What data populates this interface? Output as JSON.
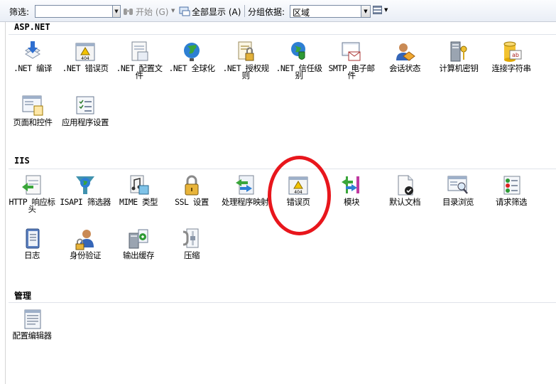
{
  "toolbar": {
    "filter_label": "筛选:",
    "filter_value": "",
    "go_label": "开始 (G)",
    "show_all_label": "全部显示 (A)",
    "group_by_label": "分组依据:",
    "group_by_value": "区域"
  },
  "sections": [
    {
      "title": "ASP.NET",
      "items": [
        {
          "label": ".NET 编译",
          "icon": "net-compile-icon"
        },
        {
          "label": ".NET 错误页",
          "icon": "net-error-pages-icon"
        },
        {
          "label": ".NET 配置文件",
          "icon": "net-profile-icon"
        },
        {
          "label": ".NET 全球化",
          "icon": "globe-icon"
        },
        {
          "label": ".NET 授权规则",
          "icon": "authorization-rules-icon"
        },
        {
          "label": ".NET 信任级别",
          "icon": "trust-levels-icon"
        },
        {
          "label": "SMTP 电子邮件",
          "icon": "smtp-email-icon"
        },
        {
          "label": "会话状态",
          "icon": "session-state-icon"
        },
        {
          "label": "计算机密钥",
          "icon": "machine-key-icon"
        },
        {
          "label": "连接字符串",
          "icon": "connection-strings-icon"
        },
        {
          "label": "页面和控件",
          "icon": "pages-controls-icon"
        },
        {
          "label": "应用程序设置",
          "icon": "app-settings-icon"
        }
      ]
    },
    {
      "title": "IIS",
      "items": [
        {
          "label": "HTTP 响应标头",
          "icon": "http-headers-icon"
        },
        {
          "label": "ISAPI 筛选器",
          "icon": "isapi-filters-icon"
        },
        {
          "label": "MIME 类型",
          "icon": "mime-types-icon"
        },
        {
          "label": "SSL 设置",
          "icon": "lock-icon"
        },
        {
          "label": "处理程序映射",
          "icon": "handler-mappings-icon"
        },
        {
          "label": "错误页",
          "icon": "error-pages-icon"
        },
        {
          "label": "模块",
          "icon": "modules-icon"
        },
        {
          "label": "默认文档",
          "icon": "default-document-icon"
        },
        {
          "label": "目录浏览",
          "icon": "directory-browsing-icon"
        },
        {
          "label": "请求筛选",
          "icon": "request-filtering-icon"
        },
        {
          "label": "日志",
          "icon": "logging-icon"
        },
        {
          "label": "身份验证",
          "icon": "authentication-icon"
        },
        {
          "label": "输出缓存",
          "icon": "output-caching-icon"
        },
        {
          "label": "压缩",
          "icon": "compression-icon"
        }
      ]
    },
    {
      "title": "管理",
      "items": [
        {
          "label": "配置编辑器",
          "icon": "configuration-editor-icon"
        }
      ]
    }
  ],
  "error_page_badge": "404",
  "colors": {
    "highlight_circle": "#e8161c",
    "toolbar_border": "#c7ccd6"
  }
}
